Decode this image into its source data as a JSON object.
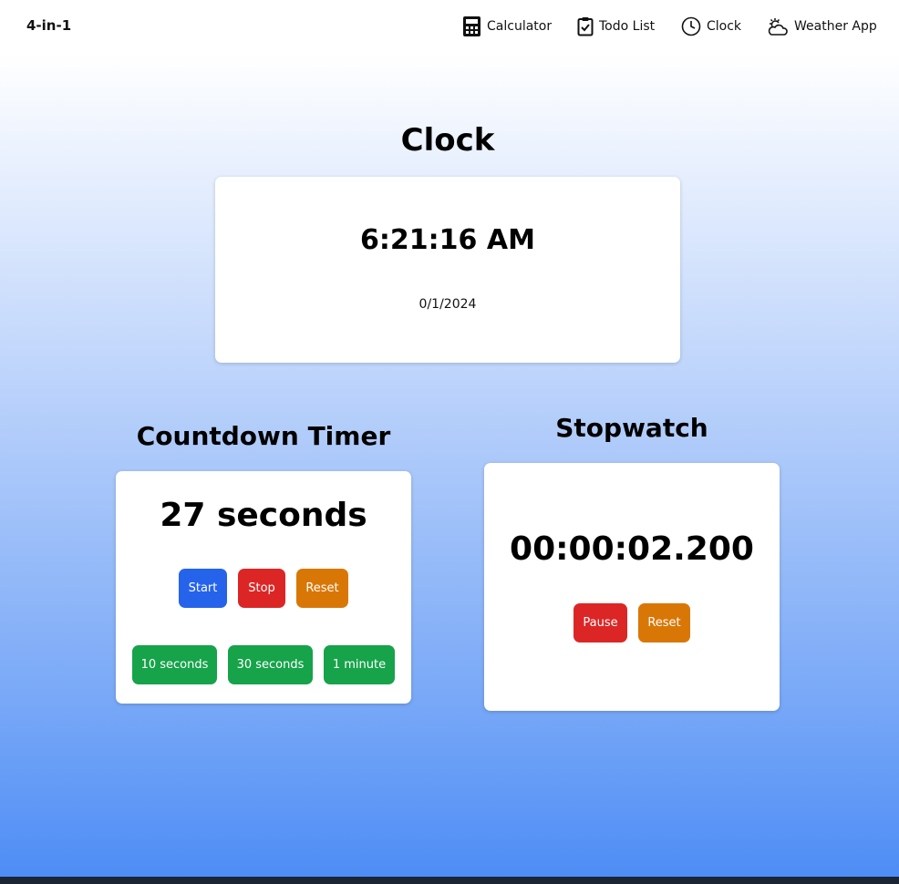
{
  "nav": {
    "brand": "4-in-1",
    "items": [
      {
        "label": "Calculator",
        "icon": "calculator-icon"
      },
      {
        "label": "Todo List",
        "icon": "clipboard-check-icon"
      },
      {
        "label": "Clock",
        "icon": "clock-icon"
      },
      {
        "label": "Weather App",
        "icon": "cloud-sun-icon"
      }
    ]
  },
  "clock": {
    "title": "Clock",
    "time": "6:21:16 AM",
    "date": "0/1/2024"
  },
  "countdown": {
    "title": "Countdown Timer",
    "value": "27 seconds",
    "start_label": "Start",
    "stop_label": "Stop",
    "reset_label": "Reset",
    "presets": [
      "10 seconds",
      "30 seconds",
      "1 minute"
    ]
  },
  "stopwatch": {
    "title": "Stopwatch",
    "value": "00:00:02.200",
    "pause_label": "Pause",
    "reset_label": "Reset"
  },
  "colors": {
    "start": "#2563eb",
    "stop": "#dc2626",
    "reset": "#d97706",
    "preset": "#16a34a",
    "background_bottom": "#4e8df5"
  }
}
